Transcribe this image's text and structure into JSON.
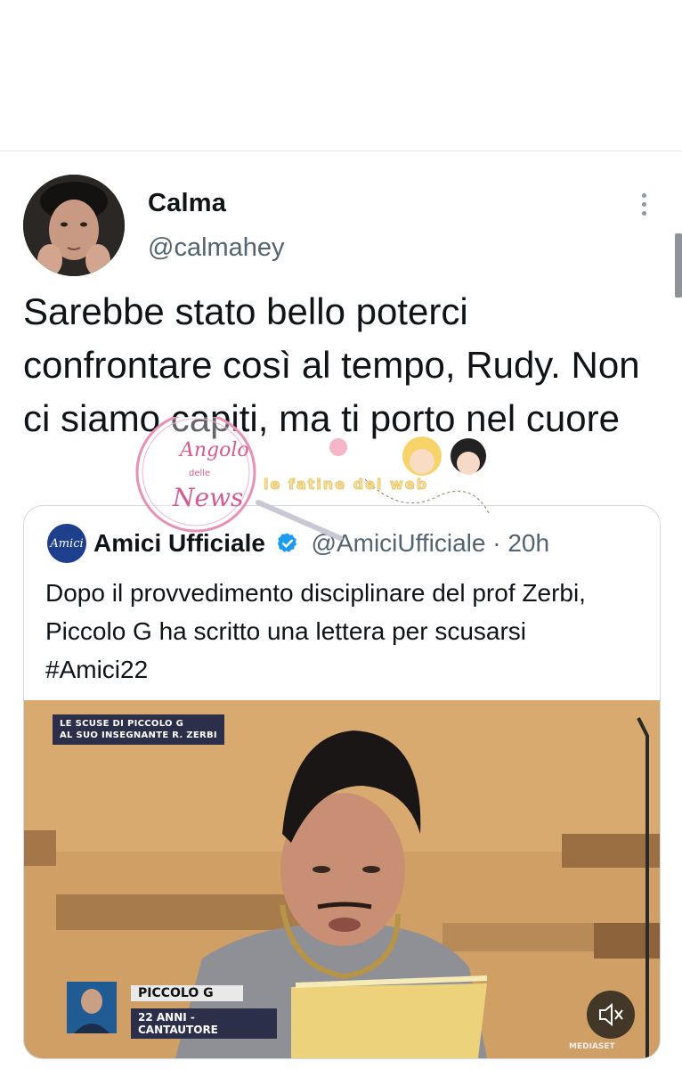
{
  "tweet": {
    "display_name": "Calma",
    "handle": "@calmahey",
    "text": "Sarebbe stato bello poterci confrontare così al tempo, Rudy. Non ci siamo capiti, ma ti porto nel cuore",
    "more_icon": "more-vertical-icon"
  },
  "quoted": {
    "avatar_text": "Amici",
    "name": "Amici Ufficiale",
    "verified_icon": "verified-badge-icon",
    "handle": "@AmiciUfficiale",
    "separator": "·",
    "time": "20h",
    "text": "Dopo il provvedimento disciplinare del prof Zerbi, Piccolo G ha scritto una lettera per scusarsi #Amici22",
    "media": {
      "caption_top_line1": "LE SCUSE DI PICCOLO G",
      "caption_top_line2": "AL SUO INSEGNANTE R. ZERBI",
      "name_tag": "PICCOLO G",
      "sub_tag": "22 ANNI - CANTAUTORE",
      "broadcaster": "MEDIASET",
      "mute_icon": "speaker-muted-icon"
    }
  },
  "watermark": {
    "logo_line1": "Angolo",
    "logo_line2": "delle",
    "logo_line3": "News",
    "site_text": "le fatine del web"
  },
  "colors": {
    "verified": "#1d9bf0",
    "secondary_text": "#536471",
    "border": "#cfd9de"
  }
}
